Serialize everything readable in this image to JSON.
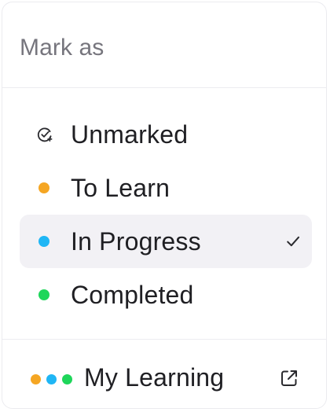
{
  "menu": {
    "title": "Mark as",
    "items": [
      {
        "label": "Unmarked",
        "icon": "check-circle-icon",
        "color": "#2a2a2e",
        "selected": false
      },
      {
        "label": "To Learn",
        "icon": "dot-icon",
        "color": "#f5a623",
        "selected": false
      },
      {
        "label": "In Progress",
        "icon": "dot-icon",
        "color": "#1fb6f5",
        "selected": true
      },
      {
        "label": "Completed",
        "icon": "dot-icon",
        "color": "#1ed65a",
        "selected": false
      }
    ],
    "footer": {
      "label": "My Learning",
      "dot_colors": [
        "#f5a623",
        "#1fb6f5",
        "#1ed65a"
      ],
      "icon": "external-link-icon"
    },
    "selected_bg": "#f2f1f5"
  }
}
